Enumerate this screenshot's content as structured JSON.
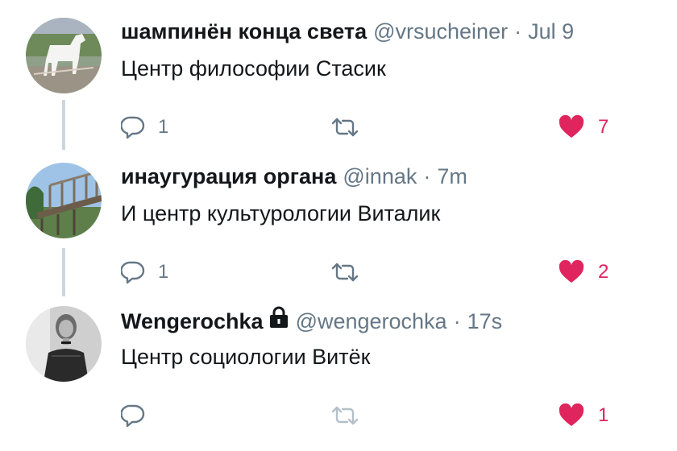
{
  "tweets": [
    {
      "name": "шампинён конца света",
      "handle": "@vrsucheiner",
      "separator": "·",
      "time": "Jul 9",
      "text": "Центр философии Стасик",
      "reply_count": "1",
      "like_count": "7",
      "protected": false,
      "avatar": "white-horse-statue"
    },
    {
      "name": "инаугурация органа",
      "handle": "@innak",
      "separator": "·",
      "time": "7m",
      "text": "И центр культурологии Виталик",
      "reply_count": "1",
      "like_count": "2",
      "protected": false,
      "avatar": "bridge-photo"
    },
    {
      "name": "Wengerochka",
      "handle": "@wengerochka",
      "separator": "·",
      "time": "17s",
      "text": "Центр социологии Витёк",
      "reply_count": "",
      "like_count": "1",
      "protected": true,
      "avatar": "woman-portrait"
    }
  ],
  "icons": {
    "reply": "reply-icon",
    "retweet": "retweet-icon",
    "like": "heart-icon",
    "lock": "lock-icon"
  },
  "colors": {
    "text": "#14171a",
    "secondary": "#657786",
    "like": "#e0245e",
    "thread_line": "#ccd6dd"
  }
}
